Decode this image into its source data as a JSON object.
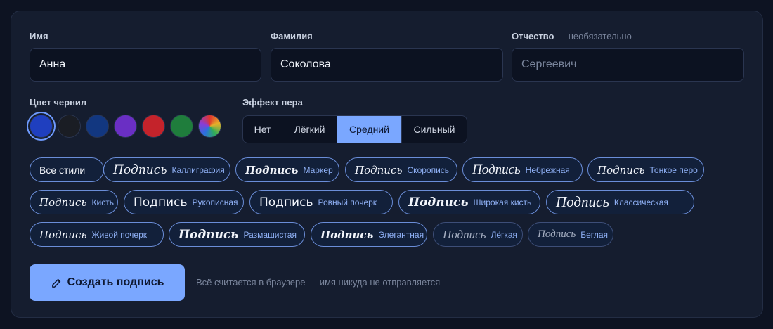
{
  "form": {
    "first_name": {
      "label": "Имя",
      "value": "Анна"
    },
    "last_name": {
      "label": "Фамилия",
      "value": "Соколова"
    },
    "patronymic": {
      "label": "Отчество",
      "optional": "— необязательно",
      "value": "",
      "placeholder": "Сергеевич"
    }
  },
  "ink": {
    "label": "Цвет чернил",
    "selected": 0,
    "colors": [
      "#1f3fbf",
      "#1a1d24",
      "#123780",
      "#6a2fc4",
      "#c4232b",
      "#1f7d3c",
      "conic-gradient"
    ]
  },
  "pen": {
    "label": "Эффект пера",
    "selected": 2,
    "options": [
      "Нет",
      "Лёгкий",
      "Средний",
      "Сильный"
    ]
  },
  "styles": {
    "all_label": "Все стили",
    "sample_text": "Подпись",
    "items": [
      "Каллиграфия",
      "Маркер",
      "Скоропись",
      "Небрежная",
      "Тонкое перо",
      "Кисть",
      "Рукописная",
      "Ровный почерк",
      "Широкая кисть",
      "Классическая",
      "Живой почерк",
      "Размашистая",
      "Элегантная",
      "Лёгкая",
      "Беглая"
    ]
  },
  "action": {
    "create_label": "Создать подпись",
    "hint": "Всё считается в браузере — имя никуда не отправляется"
  }
}
